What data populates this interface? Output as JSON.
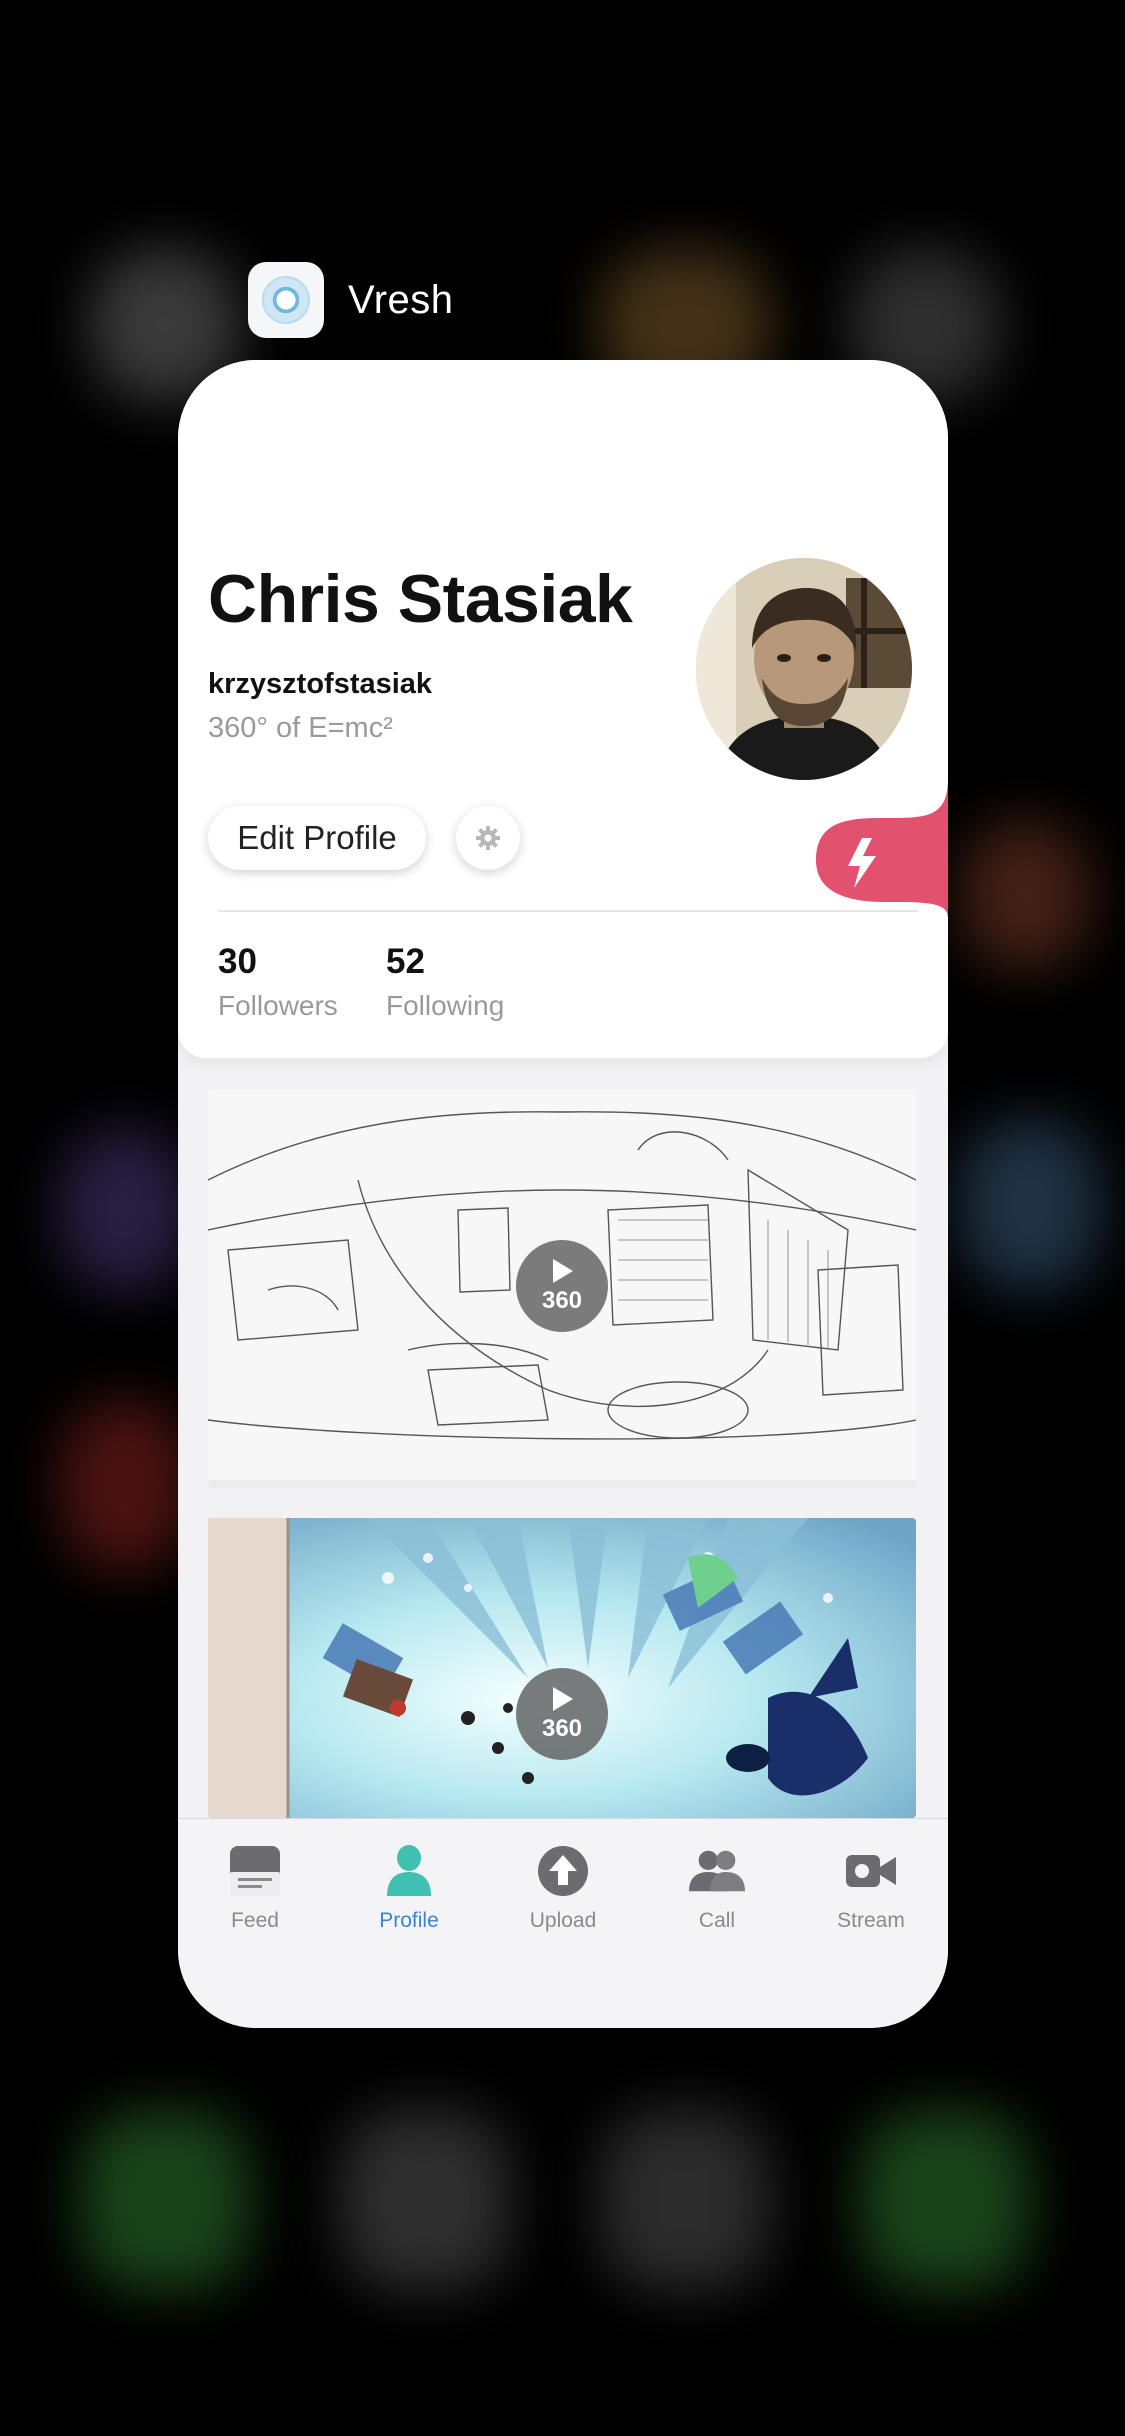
{
  "switcher": {
    "app_name": "Vresh"
  },
  "profile": {
    "name": "Chris Stasiak",
    "username": "krzysztofstasiak",
    "bio": "360° of E=mc²",
    "edit_button_label": "Edit Profile",
    "stats": [
      {
        "value": "30",
        "label": "Followers"
      },
      {
        "value": "52",
        "label": "Following"
      }
    ]
  },
  "feed": {
    "items": [
      {
        "badge_label": "360"
      },
      {
        "badge_label": "360"
      }
    ]
  },
  "tabbar": {
    "tabs": [
      {
        "label": "Feed",
        "icon": "feed-icon",
        "active": false
      },
      {
        "label": "Profile",
        "icon": "person-icon",
        "active": true
      },
      {
        "label": "Upload",
        "icon": "upload-icon",
        "active": false
      },
      {
        "label": "Call",
        "icon": "people-icon",
        "active": false
      },
      {
        "label": "Stream",
        "icon": "video-camera-icon",
        "active": false
      }
    ]
  },
  "colors": {
    "accent_pink": "#e2526f",
    "active_tab": "#3a86d4",
    "active_icon": "#3fc0b0"
  }
}
